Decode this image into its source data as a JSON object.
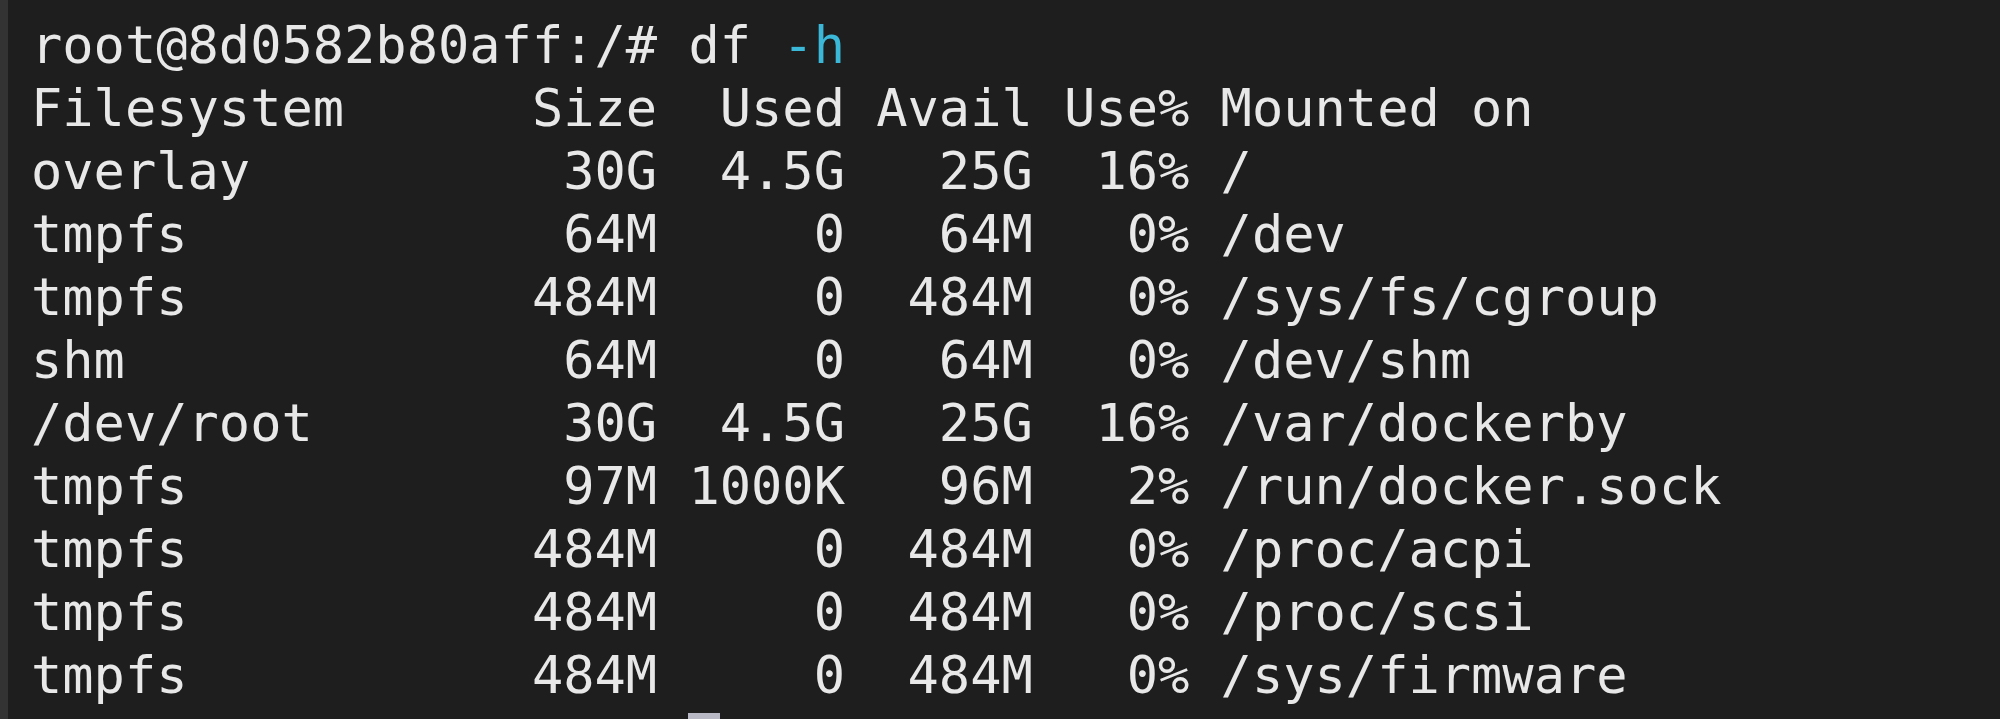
{
  "terminal": {
    "prompt": "root@8d0582b80aff:/#",
    "command": "df",
    "option": "-h",
    "columns": [
      "Filesystem",
      "Size",
      "Used",
      "Avail",
      "Use%",
      "Mounted on"
    ],
    "rows": [
      [
        "overlay",
        "30G",
        "4.5G",
        "25G",
        "16%",
        "/"
      ],
      [
        "tmpfs",
        "64M",
        "0",
        "64M",
        "0%",
        "/dev"
      ],
      [
        "tmpfs",
        "484M",
        "0",
        "484M",
        "0%",
        "/sys/fs/cgroup"
      ],
      [
        "shm",
        "64M",
        "0",
        "64M",
        "0%",
        "/dev/shm"
      ],
      [
        "/dev/root",
        "30G",
        "4.5G",
        "25G",
        "16%",
        "/var/dockerby"
      ],
      [
        "tmpfs",
        "97M",
        "1000K",
        "96M",
        "2%",
        "/run/docker.sock"
      ],
      [
        "tmpfs",
        "484M",
        "0",
        "484M",
        "0%",
        "/proc/acpi"
      ],
      [
        "tmpfs",
        "484M",
        "0",
        "484M",
        "0%",
        "/proc/scsi"
      ],
      [
        "tmpfs",
        "484M",
        "0",
        "484M",
        "0%",
        "/sys/firmware"
      ]
    ]
  }
}
